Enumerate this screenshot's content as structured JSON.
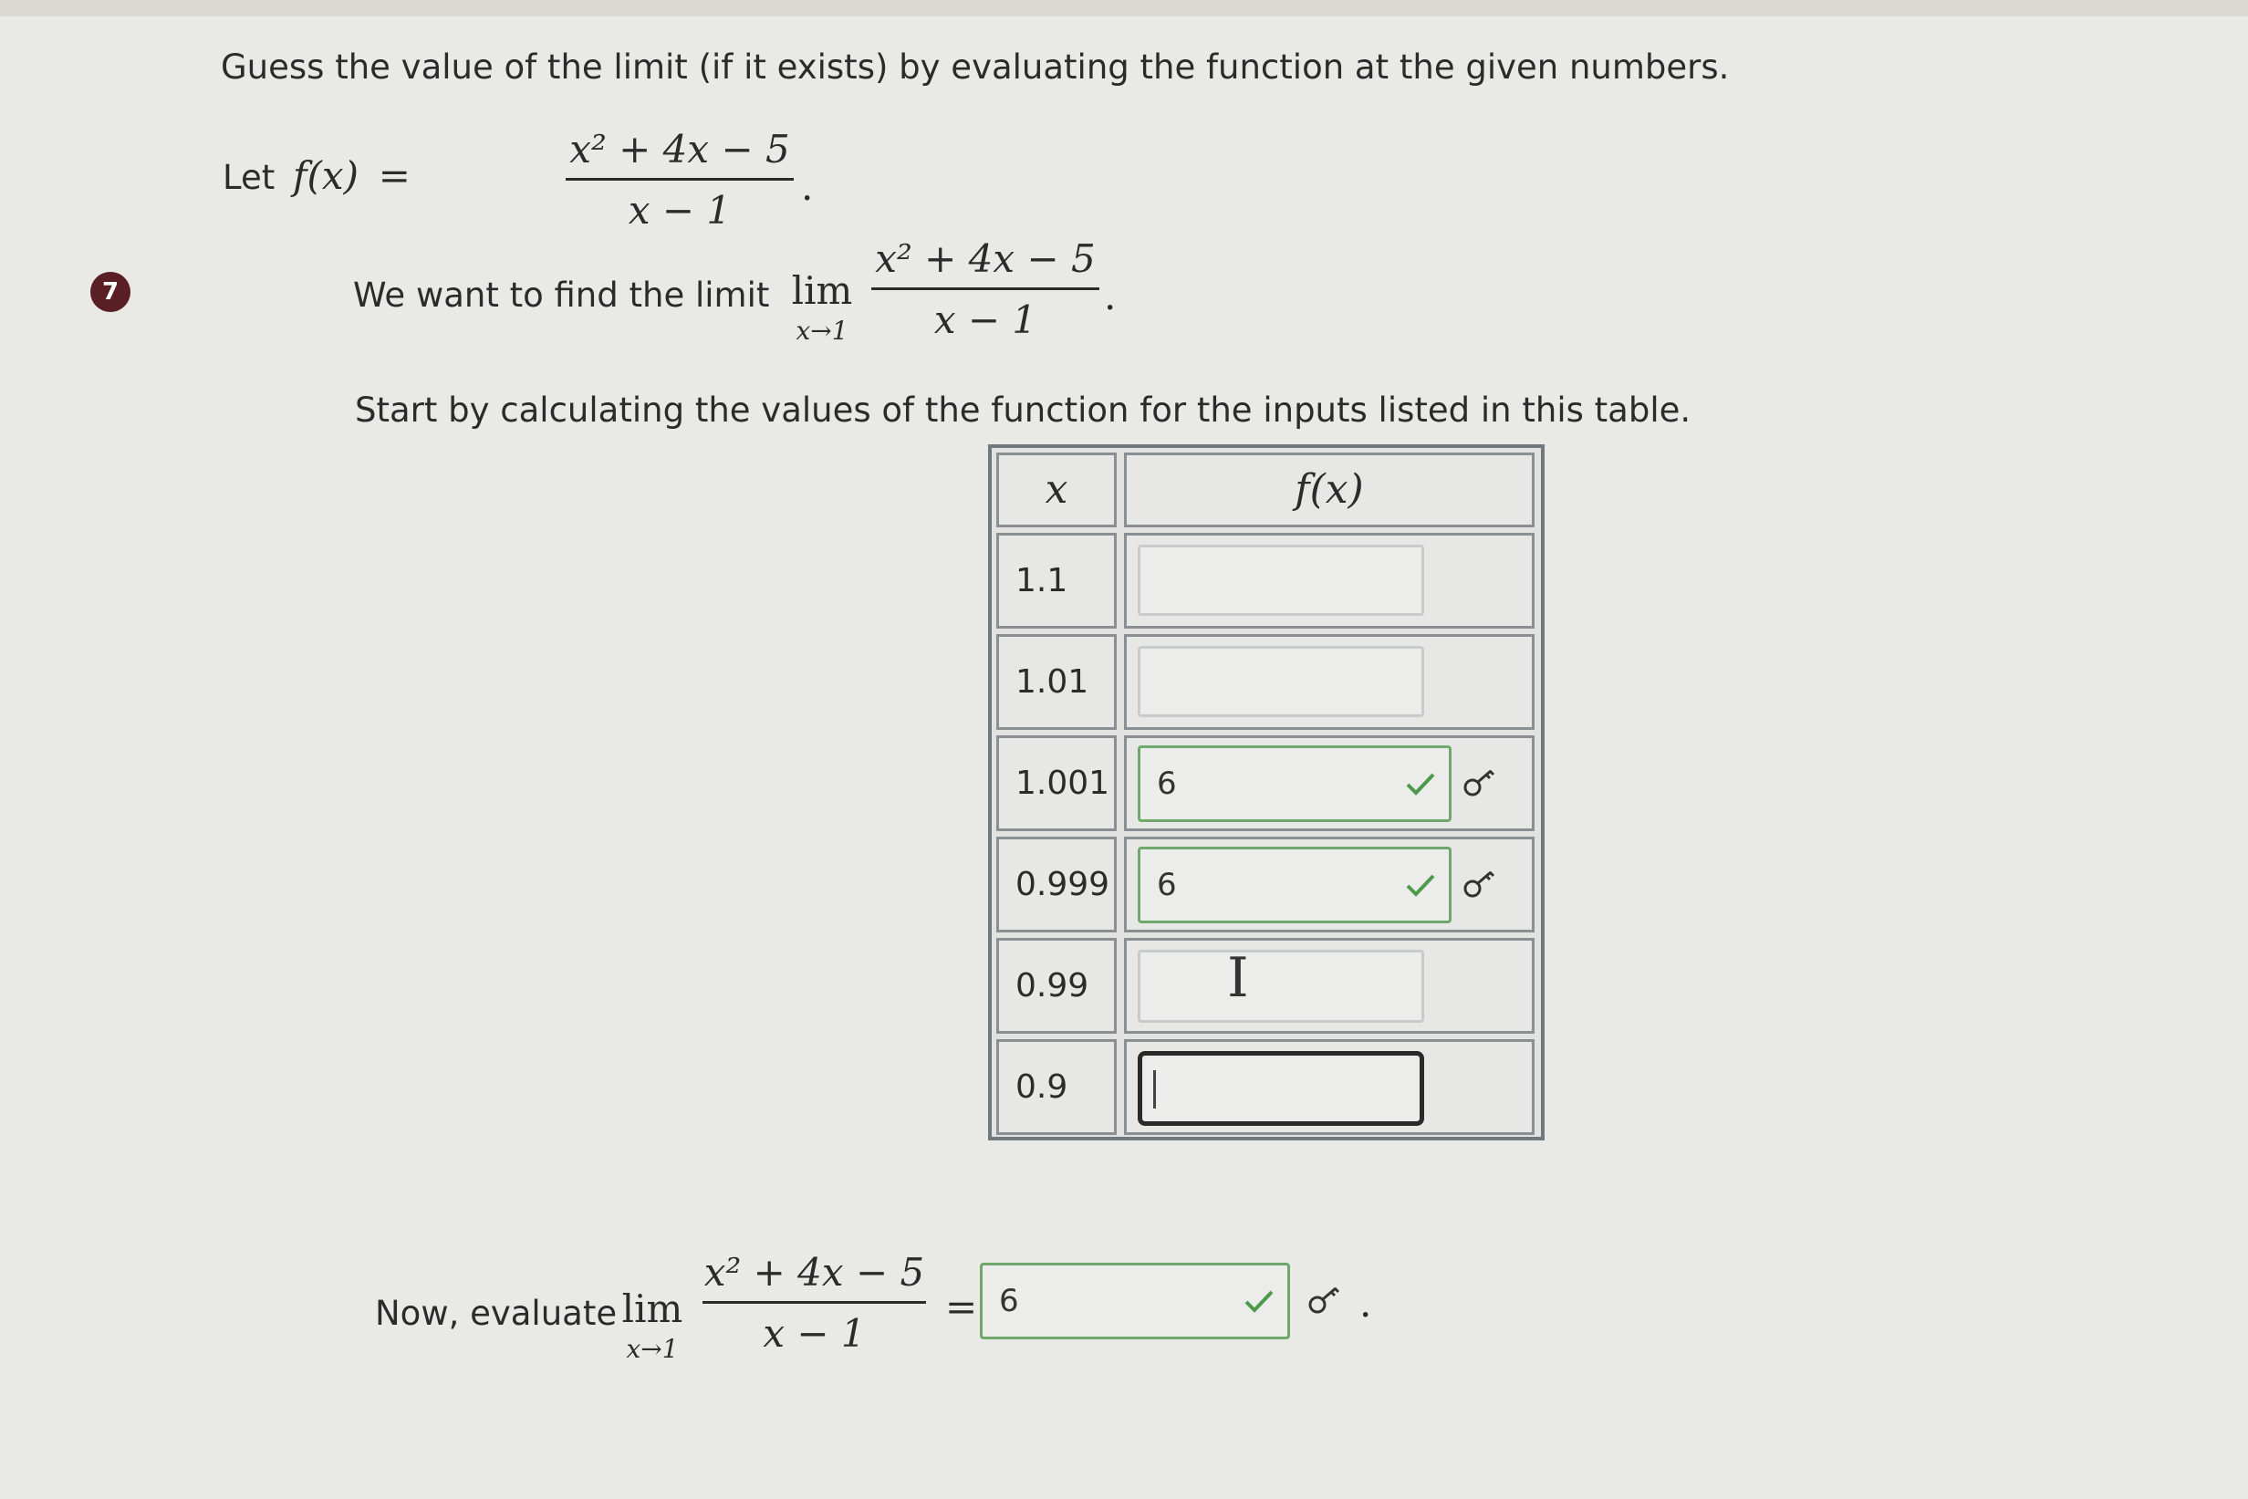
{
  "question_number": "7",
  "instruction": "Guess the value of the limit (if it exists) by evaluating the function at the given numbers.",
  "let_text": "Let",
  "fx_label": "f(x)",
  "numerator": "x² + 4x − 5",
  "denominator": "x − 1",
  "find_text": "We want to find the limit",
  "lim_word": "lim",
  "lim_sub": "x→1",
  "start_text": "Start by calculating the values of the function for the inputs listed in this table.",
  "table": {
    "header_x": "x",
    "header_fx": "f(x)",
    "rows": [
      {
        "x": "1.1",
        "value": "",
        "status": "empty"
      },
      {
        "x": "1.01",
        "value": "",
        "status": "empty"
      },
      {
        "x": "1.001",
        "value": "6",
        "status": "correct"
      },
      {
        "x": "0.999",
        "value": "6",
        "status": "correct"
      },
      {
        "x": "0.99",
        "value": "",
        "status": "empty"
      },
      {
        "x": "0.9",
        "value": "",
        "status": "active"
      }
    ]
  },
  "evaluate_text": "Now, evaluate",
  "final_answer": "6",
  "equals": "=",
  "period": ".",
  "icons": [
    "check-icon",
    "key-icon",
    "text-cursor-icon"
  ],
  "colors": {
    "badge": "#5a1f24",
    "correct_border": "#6ea86a",
    "check": "#4f9a4a"
  }
}
